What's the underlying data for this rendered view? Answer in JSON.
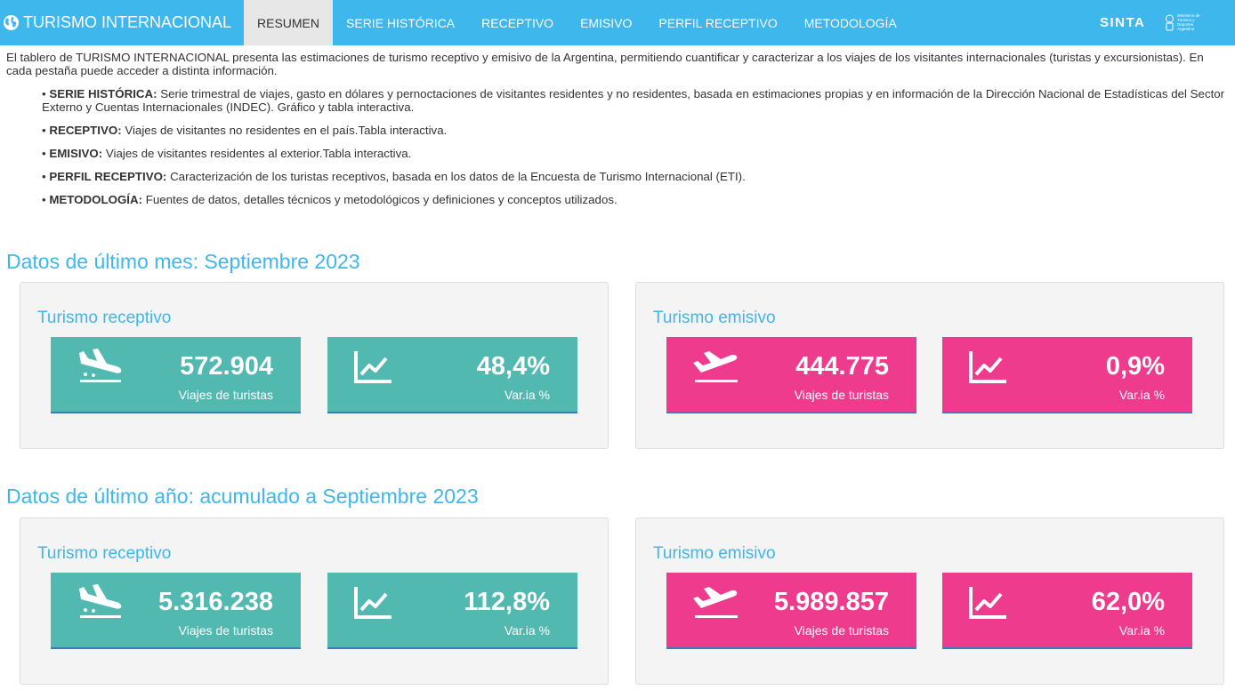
{
  "navbar": {
    "brand": "TURISMO INTERNACIONAL",
    "tabs": [
      {
        "label": "RESUMEN",
        "active": true
      },
      {
        "label": "SERIE HISTÓRICA",
        "active": false
      },
      {
        "label": "RECEPTIVO",
        "active": false
      },
      {
        "label": "EMISIVO",
        "active": false
      },
      {
        "label": "PERFIL RECEPTIVO",
        "active": false
      },
      {
        "label": "METODOLOGÍA",
        "active": false
      }
    ],
    "sinta": "SINTA",
    "ministry_logo_text": "Ministerio de Turismo y Deportes Argentina"
  },
  "intro": "El tablero de TURISMO INTERNACIONAL presenta las estimaciones de turismo receptivo y emisivo de la Argentina, permitiendo cuantificar y caracterizar a los viajes de los visitantes internacionales (turistas y excursionistas). En cada pestaña puede acceder a distinta información.",
  "bullets": [
    {
      "term": "SERIE HISTÓRICA:",
      "text": "Serie trimestral de viajes, gasto en dólares y pernoctaciones de visitantes residentes y no residentes, basada en estimaciones propias y en información de la Dirección Nacional de Estadísticas del Sector Externo y Cuentas Internacionales (INDEC). Gráfico y tabla interactiva."
    },
    {
      "term": "RECEPTIVO:",
      "text": "Viajes de visitantes no residentes en el país.Tabla interactiva."
    },
    {
      "term": "EMISIVO:",
      "text": "Viajes de visitantes residentes al exterior.Tabla interactiva."
    },
    {
      "term": "PERFIL RECEPTIVO:",
      "text": "Caracterización de los turistas receptivos, basada en los datos de la Encuesta de Turismo Internacional (ETI)."
    },
    {
      "term": "METODOLOGÍA:",
      "text": "Fuentes de datos, detalles técnicos y metodológicos y definiciones y conceptos utilizados."
    }
  ],
  "sections": [
    {
      "title": "Datos de último mes: Septiembre 2023",
      "receptivo": {
        "title": "Turismo receptivo",
        "trips_value": "572.904",
        "trips_label": "Viajes de turistas",
        "var_value": "48,4%",
        "var_label": "Var.ia %"
      },
      "emisivo": {
        "title": "Turismo emisivo",
        "trips_value": "444.775",
        "trips_label": "Viajes de turistas",
        "var_value": "0,9%",
        "var_label": "Var.ia %"
      }
    },
    {
      "title": "Datos de último año: acumulado a Septiembre 2023",
      "receptivo": {
        "title": "Turismo receptivo",
        "trips_value": "5.316.238",
        "trips_label": "Viajes de turistas",
        "var_value": "112,8%",
        "var_label": "Var.ia %"
      },
      "emisivo": {
        "title": "Turismo emisivo",
        "trips_value": "5.989.857",
        "trips_label": "Viajes de turistas",
        "var_value": "62,0%",
        "var_label": "Var.ia %"
      }
    }
  ],
  "colors": {
    "navbar": "#3db7ec",
    "title_blue": "#3db7ec",
    "receptivo_tile": "#52b9b1",
    "emisivo_tile": "#ee3b8e",
    "active_tab_bg": "#e7e7e7",
    "panel_bg": "#f4f4f4"
  },
  "icons": {
    "brand": "globe-icon",
    "arrival": "plane-arrival-icon",
    "departure": "plane-departure-icon",
    "variation": "line-chart-icon"
  }
}
